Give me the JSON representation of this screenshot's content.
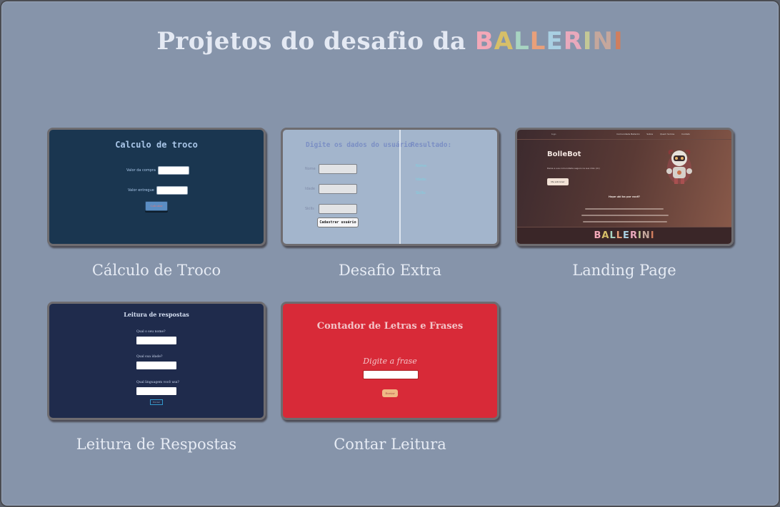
{
  "page": {
    "title": "Projetos do desafio da",
    "brand": "BALLERINI",
    "brand_colors": [
      "#f3a8b8",
      "#d7bf68",
      "#a8d4c2",
      "#e9a07a",
      "#a9d0e3",
      "#e9a9bc",
      "#c4c896",
      "#c5a79c",
      "#d07e5e"
    ]
  },
  "projects": [
    {
      "caption": "Cálculo de Troco",
      "preview": {
        "heading": "Calculo de troco",
        "fields": [
          "Valor da compra",
          "Valor entregue"
        ],
        "button": "Calcular"
      }
    },
    {
      "caption": "Desafio Extra",
      "preview": {
        "heading": "Digite os dados do usuário",
        "result_heading": "Resultado:",
        "fields": [
          "Nome",
          "Idade",
          "Skills"
        ],
        "button": "Cadastrar usuário",
        "results": [
          "Nome:",
          "Idade:",
          "Skills:"
        ]
      }
    },
    {
      "caption": "Landing Page",
      "preview": {
        "nav_logo": "logo",
        "nav_links": [
          "Comunidade Ballerini",
          "Sobre",
          "Quem Somos",
          "Contato"
        ],
        "heading": "BolleBot",
        "subtitle": "Deixe a sua comunidade segura na sua mão (dc)",
        "cta": "Me adicione!",
        "question": "Hope ubi ba por você?",
        "footer_brand": "BALLERINI"
      }
    },
    {
      "caption": "Leitura de Respostas",
      "preview": {
        "heading": "Leitura de respostas",
        "fields": [
          "Qual o seu nome?",
          "Qual sua idade?",
          "Qual linguagem você usa?"
        ],
        "button": "Enviar"
      }
    },
    {
      "caption": "Contar Leitura",
      "preview": {
        "heading": "Contador de Letras e Frases",
        "label": "Digite a frase",
        "button": "Enviar"
      }
    }
  ]
}
